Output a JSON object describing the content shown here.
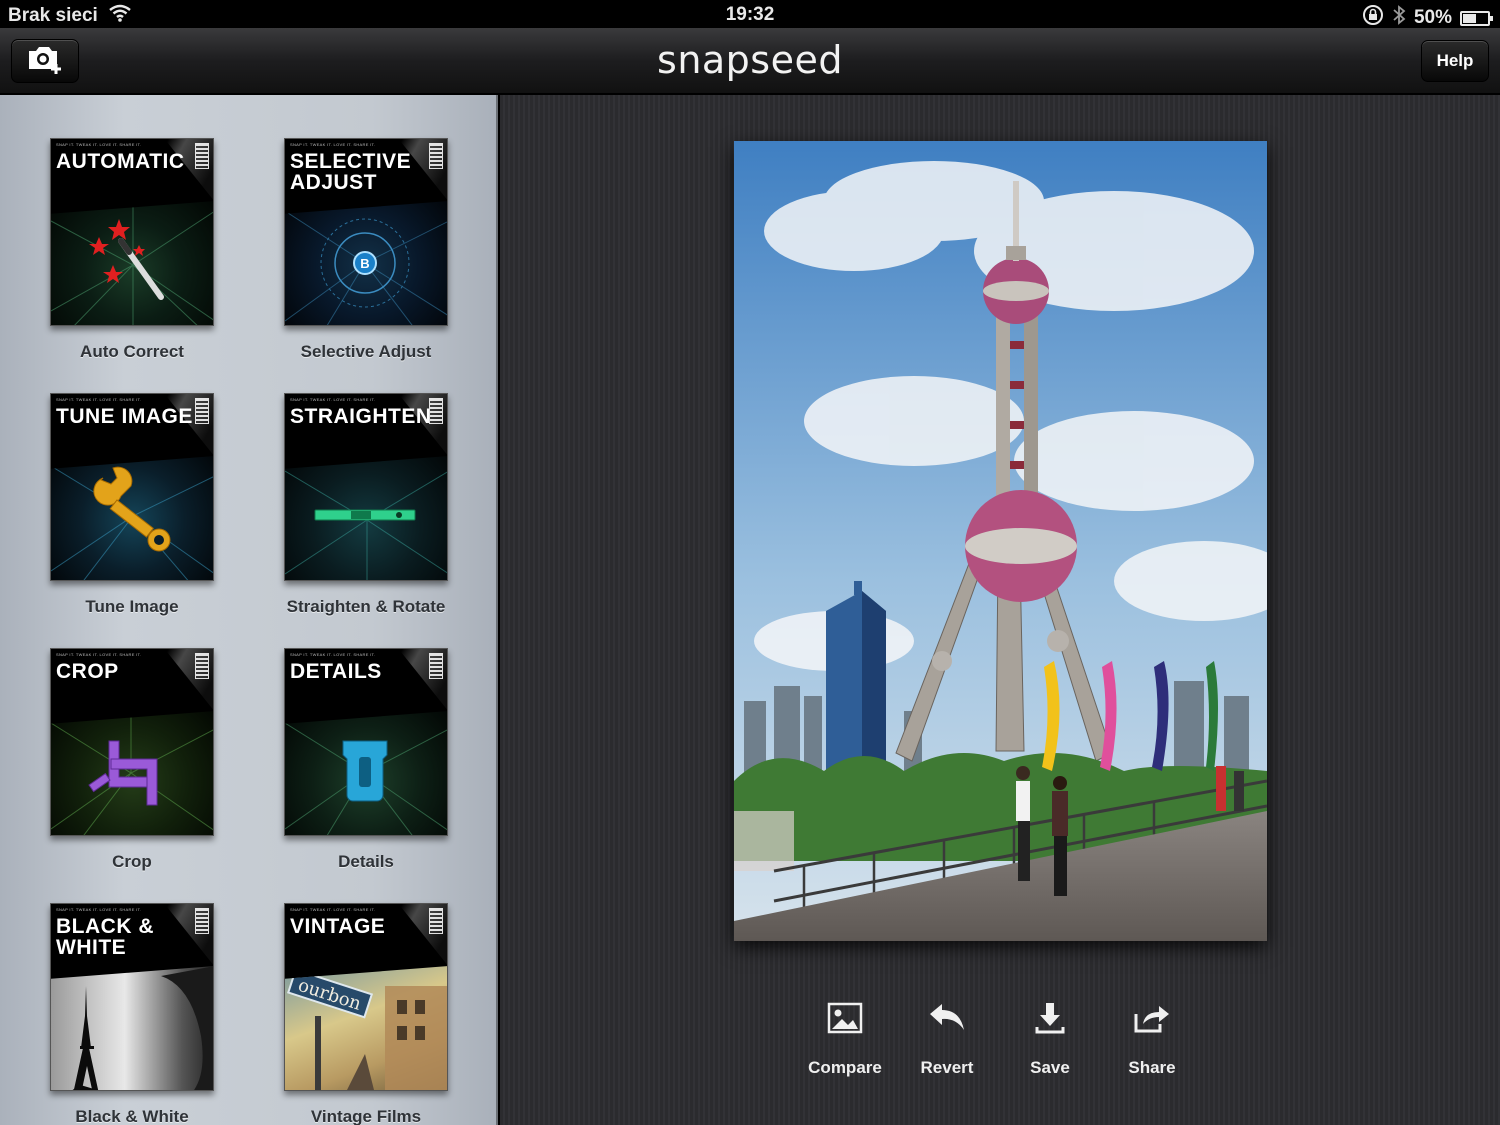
{
  "status_bar": {
    "carrier": "Brak sieci",
    "time": "19:32",
    "battery": "50%",
    "battery_level": 0.5
  },
  "app_bar": {
    "logo": "snapseed",
    "help_label": "Help",
    "camera_icon": "camera-add-icon"
  },
  "tools": [
    {
      "title_line1": "AUTOMATIC",
      "title_line2": "",
      "label": "Auto Correct",
      "icon": "magic-wand-icon"
    },
    {
      "title_line1": "SELECTIVE",
      "title_line2": "ADJUST",
      "label": "Selective Adjust",
      "icon": "control-point-icon"
    },
    {
      "title_line1": "TUNE IMAGE",
      "title_line2": "",
      "label": "Tune Image",
      "icon": "wrench-icon"
    },
    {
      "title_line1": "STRAIGHTEN",
      "title_line2": "",
      "label": "Straighten & Rotate",
      "icon": "level-icon"
    },
    {
      "title_line1": "CROP",
      "title_line2": "",
      "label": "Crop",
      "icon": "crop-icon"
    },
    {
      "title_line1": "DETAILS",
      "title_line2": "",
      "label": "Details",
      "icon": "sharpener-icon"
    },
    {
      "title_line1": "BLACK &",
      "title_line2": "WHITE",
      "label": "Black & White",
      "icon": "eiffel-tower-icon"
    },
    {
      "title_line1": "VINTAGE",
      "title_line2": "",
      "label": "Vintage Films",
      "icon": "vintage-street-icon"
    }
  ],
  "tile_tagline": "SNAP IT. TWEAK IT. LOVE IT. SHARE IT.",
  "selective_point_label": "B",
  "vintage_sign_text": "ourbon",
  "actions": [
    {
      "label": "Compare",
      "icon": "image-icon"
    },
    {
      "label": "Revert",
      "icon": "undo-arrow-icon"
    },
    {
      "label": "Save",
      "icon": "download-icon"
    },
    {
      "label": "Share",
      "icon": "share-icon"
    }
  ]
}
